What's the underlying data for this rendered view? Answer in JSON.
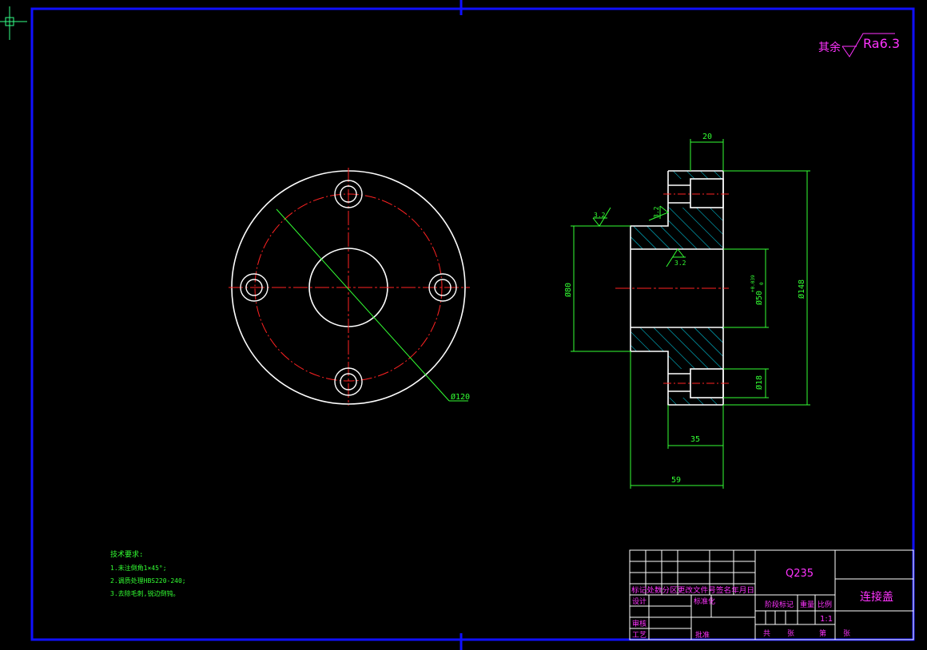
{
  "roughness": {
    "prefix": "其余",
    "value": "Ra6.3"
  },
  "dimensions": {
    "d120": "Ø120",
    "w20": "20",
    "ra_a": "3.2",
    "ra_b": "3.2",
    "ra_c": "3.2",
    "d80": "Ø80",
    "d50": "Ø50",
    "d50_upper": "+0.039",
    "d50_lower": "0",
    "d148": "Ø148",
    "d18": "Ø18",
    "l35": "35",
    "l59": "59"
  },
  "notes": {
    "title": "技术要求:",
    "line1": "1.未注倒角1×45°;",
    "line2": "2.调质处理HBS220-240;",
    "line3": "3.去除毛刺,锐边倒钝。"
  },
  "title_block": {
    "material": "Q235",
    "part_name": "连接盖",
    "revision_header": "标记处数分区更改文件号签名年月日",
    "design": "设计",
    "standardize": "标准化",
    "stage_mark": "阶段标记",
    "weight": "重量",
    "scale": "比例",
    "scale_value": "1:1",
    "review": "审核",
    "process": "工艺",
    "approve": "批准",
    "total": "共",
    "sheet": "张",
    "page_no": "第",
    "sheet2": "张"
  },
  "colors": {
    "border": "#1010ff",
    "outline": "#ffffff",
    "centerline": "#ff2222",
    "dimension": "#33ff33",
    "text": "#ff33ff",
    "hatch": "#00e5ff",
    "background": "#000000"
  }
}
